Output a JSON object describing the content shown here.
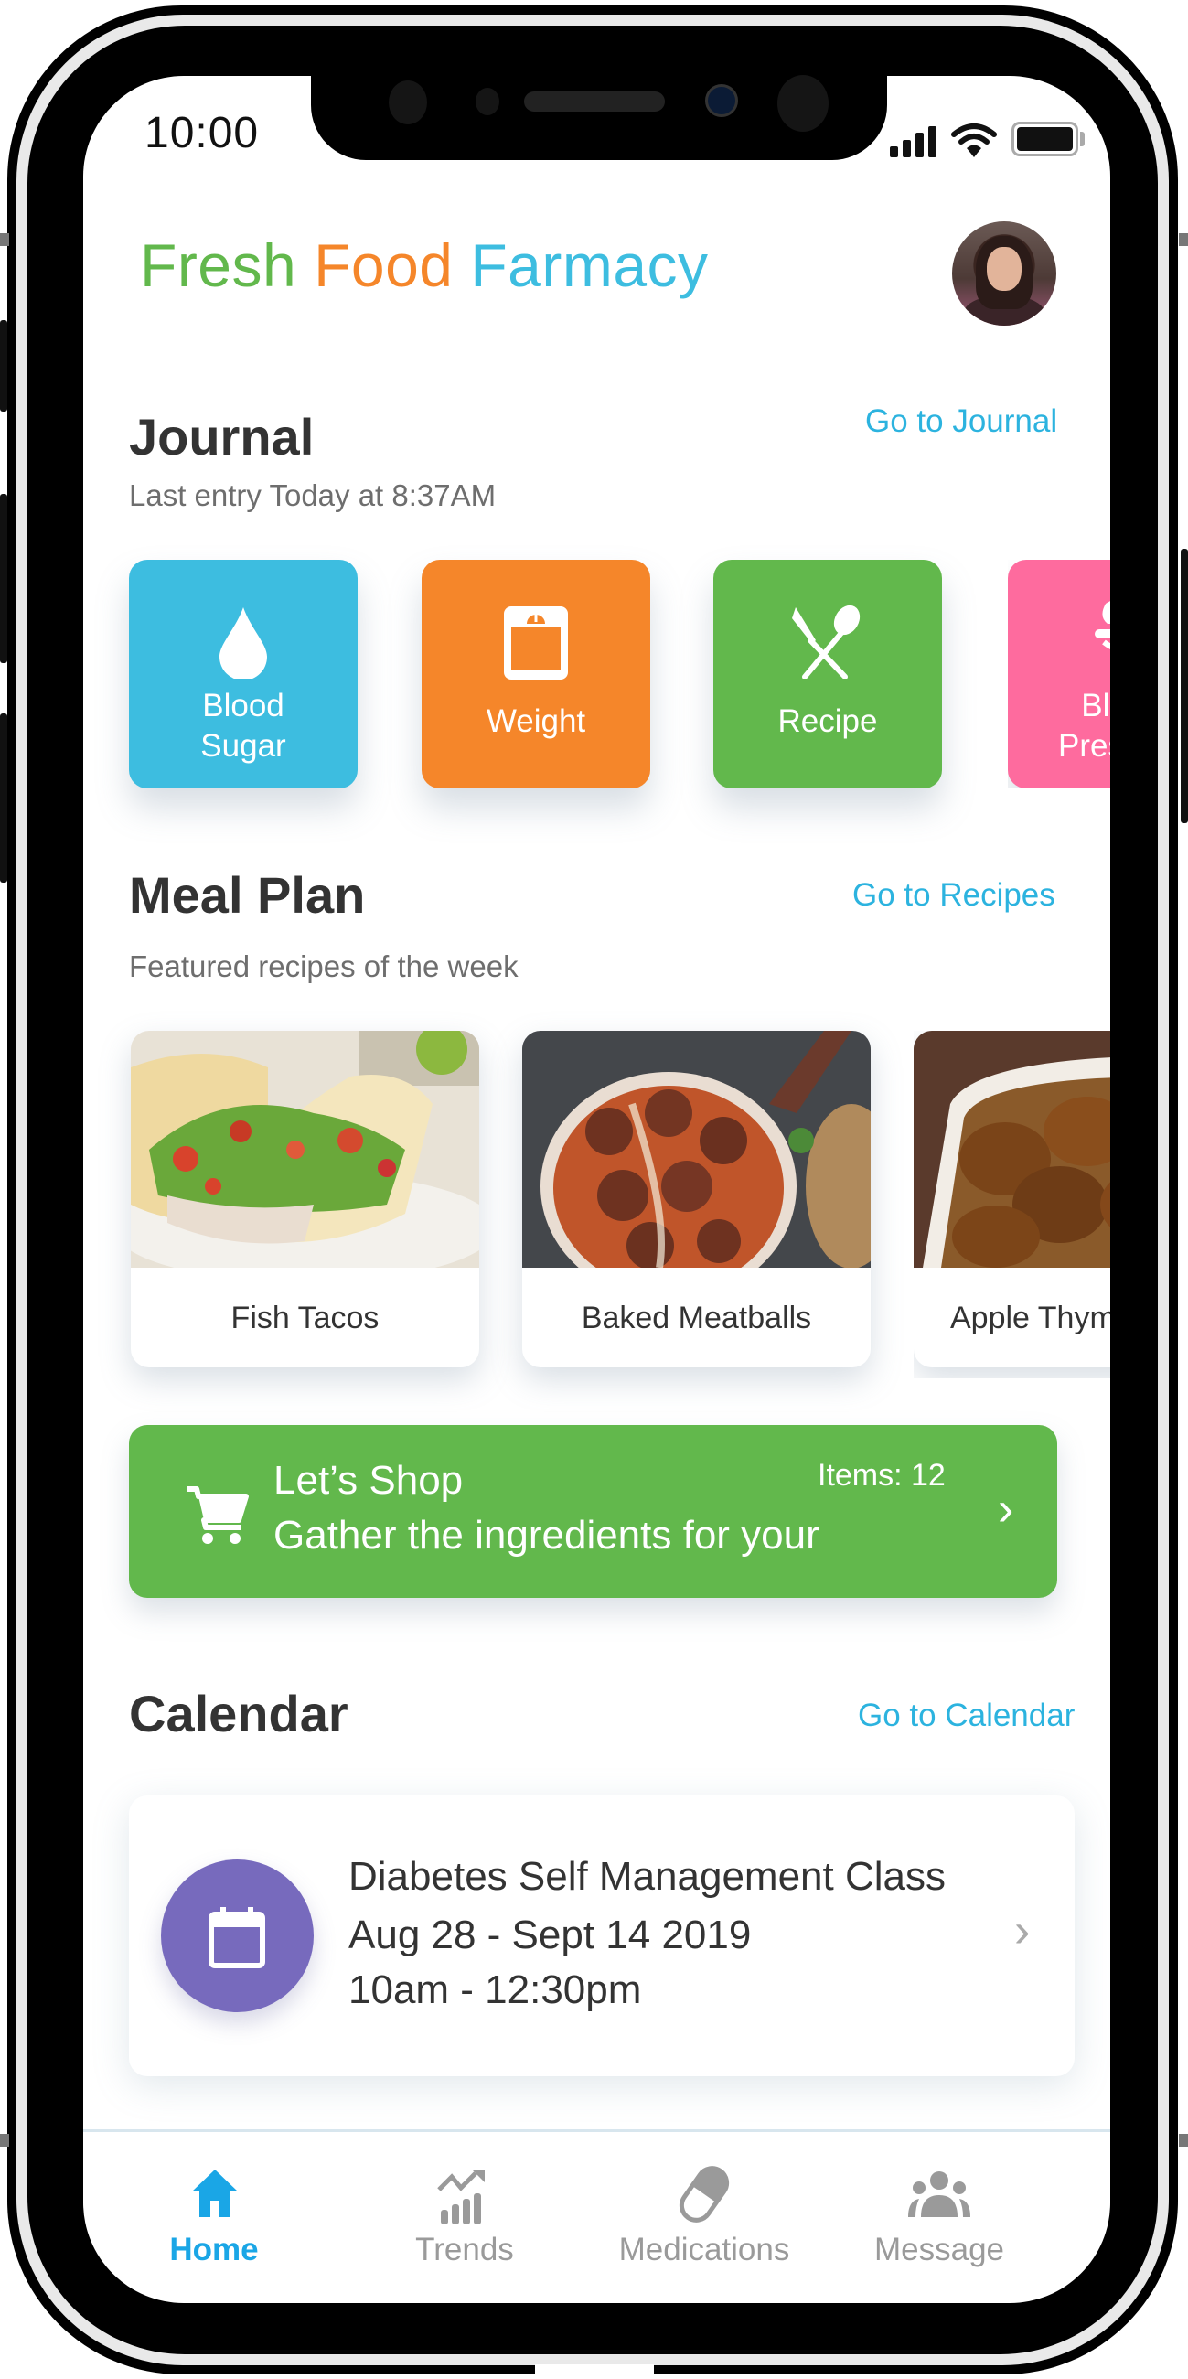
{
  "status_bar": {
    "time": "10:00",
    "icons": [
      "cellular-signal-icon",
      "wifi-icon",
      "battery-icon"
    ]
  },
  "header": {
    "brand_parts": [
      "Fresh",
      "Food",
      "Farmacy"
    ],
    "brand_colors": [
      "#62b84c",
      "#f5862a",
      "#3dbde0"
    ],
    "avatar_icon": "user-avatar"
  },
  "journal": {
    "title": "Journal",
    "link": "Go to Journal",
    "subtitle": "Last entry Today at 8:37AM",
    "tiles": [
      {
        "label_line1": "Blood",
        "label_line2": "Sugar",
        "icon": "drop-icon",
        "color": "#3dbde0"
      },
      {
        "label_line1": "Weight",
        "label_line2": "",
        "icon": "scale-icon",
        "color": "#f5862a"
      },
      {
        "label_line1": "Recipe",
        "label_line2": "",
        "icon": "utensils-icon",
        "color": "#62b84c"
      },
      {
        "label_line1": "Blood",
        "label_line2": "Pressure",
        "icon": "blood-pressure-icon",
        "color": "#fe6b9e"
      }
    ]
  },
  "meal_plan": {
    "title": "Meal Plan",
    "link": "Go to Recipes",
    "subtitle": "Featured recipes of the week",
    "recipes": [
      {
        "name": "Fish Tacos"
      },
      {
        "name": "Baked Meatballs"
      },
      {
        "name": "Apple Thyme Chicken"
      }
    ]
  },
  "shop": {
    "title": "Let’s Shop",
    "subtitle": "Gather the ingredients for your",
    "items": "Items: 12",
    "icon": "cart-icon",
    "chevron": "›",
    "color": "#62b84c"
  },
  "calendar": {
    "title": "Calendar",
    "link": "Go to Calendar",
    "event": {
      "title": "Diabetes Self Management Class",
      "date": "Aug 28 - Sept 14 2019",
      "time": "10am - 12:30pm",
      "icon": "calendar-icon",
      "chevron": "›",
      "color": "#776abd"
    }
  },
  "bottom_nav": {
    "items": [
      {
        "label": "Home",
        "icon": "home-icon",
        "active": true
      },
      {
        "label": "Trends",
        "icon": "trends-icon",
        "active": false
      },
      {
        "label": "Medications",
        "icon": "pill-icon",
        "active": false
      },
      {
        "label": "Message",
        "icon": "group-icon",
        "active": false
      }
    ],
    "active_color": "#1aa6e6",
    "inactive_color": "#9a9a9a"
  }
}
